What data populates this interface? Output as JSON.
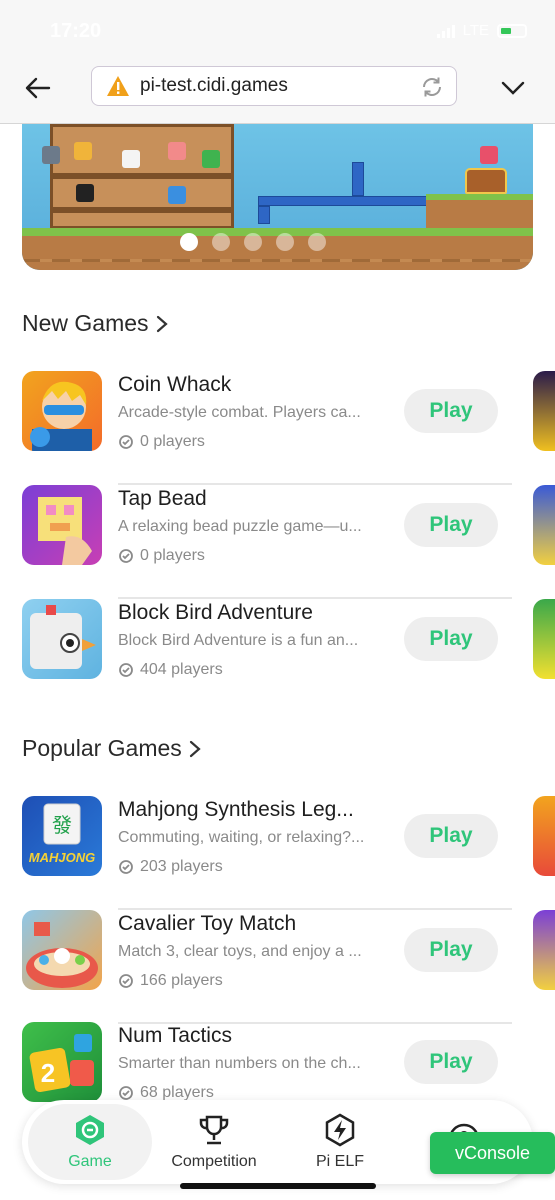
{
  "status_bar": {
    "time": "17:20",
    "network": "LTE"
  },
  "browser": {
    "url": "pi-test.cidi.games"
  },
  "banner": {
    "slide_count": 5,
    "active_slide": 1
  },
  "new_games": {
    "title": "New Games",
    "items": [
      {
        "name": "Coin Whack",
        "description": "Arcade-style combat. Players ca...",
        "players": "0 players",
        "play_label": "Play"
      },
      {
        "name": "Tap Bead",
        "description": "A relaxing bead puzzle game—u...",
        "players": "0 players",
        "play_label": "Play"
      },
      {
        "name": "Block Bird Adventure",
        "description": "Block Bird Adventure is a fun an...",
        "players": "404 players",
        "play_label": "Play"
      }
    ]
  },
  "popular_games": {
    "title": "Popular Games",
    "items": [
      {
        "name": "Mahjong Synthesis Leg...",
        "description": "Commuting, waiting, or relaxing?...",
        "players": "203 players",
        "play_label": "Play",
        "thumb_text": "MAHJONG"
      },
      {
        "name": "Cavalier Toy Match",
        "description": "Match 3, clear toys, and enjoy a ...",
        "players": "166 players",
        "play_label": "Play"
      },
      {
        "name": "Num Tactics",
        "description": "Smarter than numbers on the ch...",
        "players": "68 players",
        "play_label": "Play",
        "thumb_text": "2"
      }
    ]
  },
  "bottom_nav": {
    "items": [
      {
        "label": "Game",
        "icon": "game-icon",
        "active": true
      },
      {
        "label": "Competition",
        "icon": "trophy-icon",
        "active": false
      },
      {
        "label": "Pi ELF",
        "icon": "bolt-icon",
        "active": false
      },
      {
        "label": "",
        "icon": "profile-icon",
        "active": false
      }
    ]
  },
  "vconsole": {
    "label": "vConsole"
  },
  "colors": {
    "accent": "#2fc57a",
    "vconsole": "#26bd5c",
    "warning": "#f0a01a"
  }
}
